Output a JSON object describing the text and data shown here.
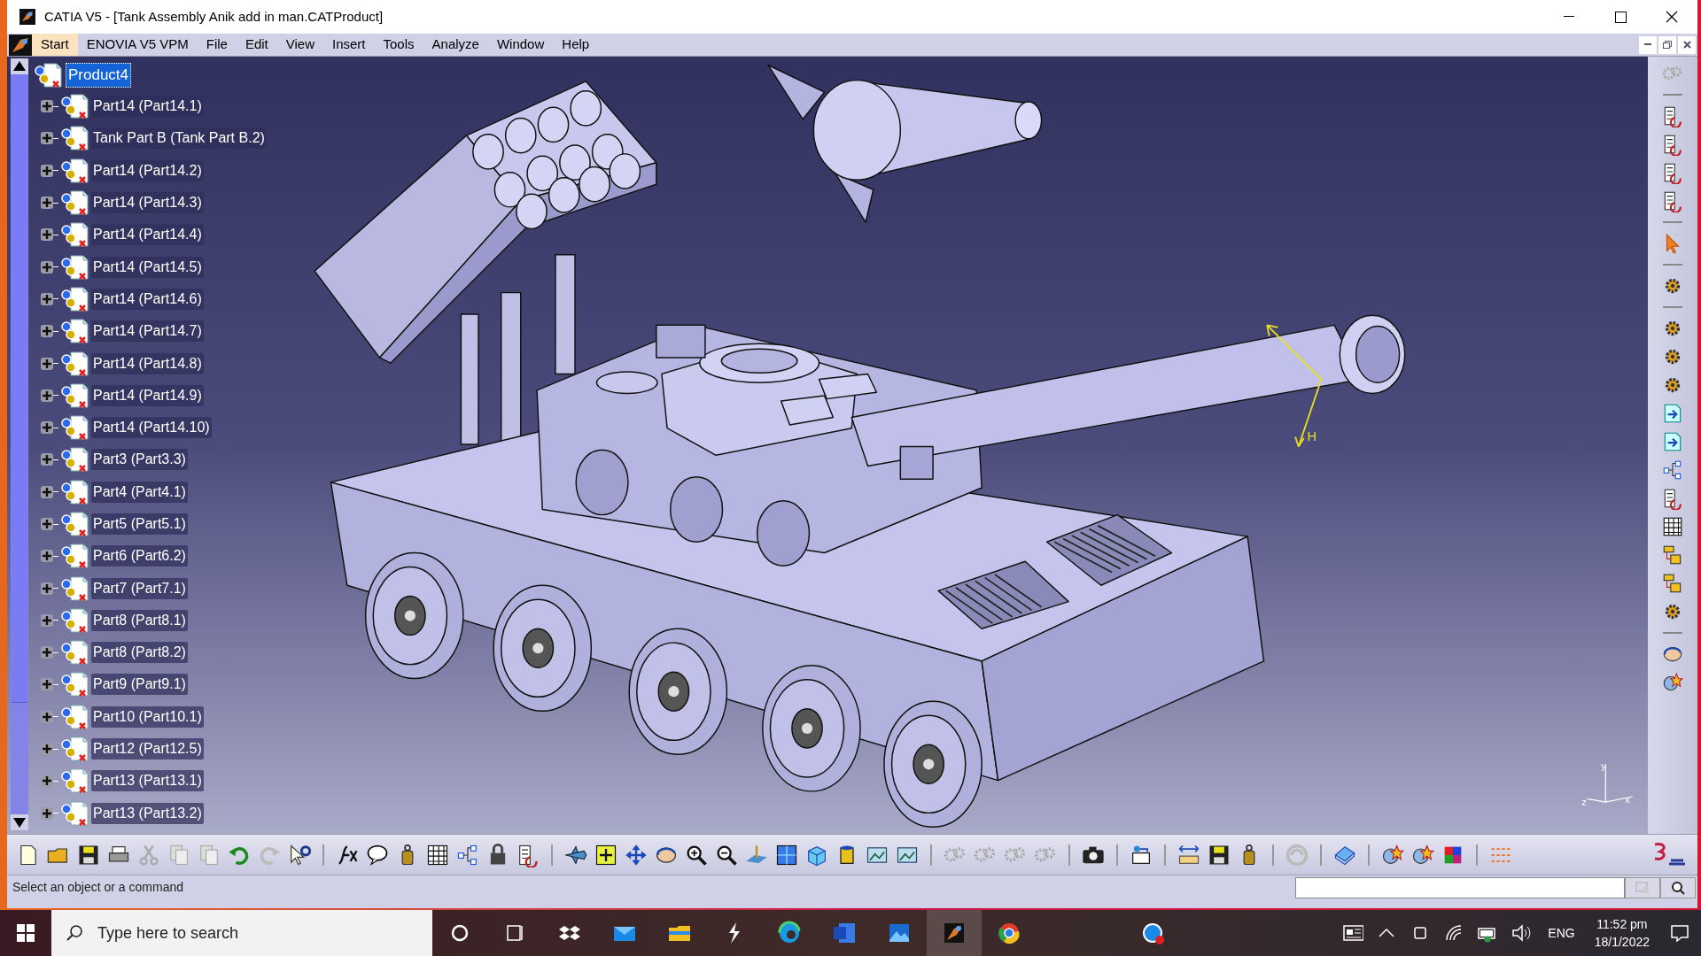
{
  "window": {
    "title": "CATIA V5 - [Tank Assembly Anik add in man.CATProduct]"
  },
  "menu": [
    {
      "label": "Start",
      "selected": true
    },
    {
      "label": "ENOVIA V5 VPM",
      "selected": false
    },
    {
      "label": "File",
      "selected": false
    },
    {
      "label": "Edit",
      "selected": false
    },
    {
      "label": "View",
      "selected": false
    },
    {
      "label": "Insert",
      "selected": false
    },
    {
      "label": "Tools",
      "selected": false
    },
    {
      "label": "Analyze",
      "selected": false
    },
    {
      "label": "Window",
      "selected": false
    },
    {
      "label": "Help",
      "selected": false
    }
  ],
  "tree": {
    "root": {
      "label": "Product4",
      "selected": true
    },
    "children": [
      {
        "label": "Part14 (Part14.1)",
        "expanded": false
      },
      {
        "label": "Tank Part B (Tank Part B.2)",
        "expanded": false
      },
      {
        "label": "Part14 (Part14.2)",
        "expanded": false
      },
      {
        "label": "Part14 (Part14.3)",
        "expanded": false
      },
      {
        "label": "Part14 (Part14.4)",
        "expanded": false
      },
      {
        "label": "Part14 (Part14.5)",
        "expanded": false
      },
      {
        "label": "Part14 (Part14.6)",
        "expanded": false
      },
      {
        "label": "Part14 (Part14.7)",
        "expanded": false
      },
      {
        "label": "Part14 (Part14.8)",
        "expanded": false
      },
      {
        "label": "Part14 (Part14.9)",
        "expanded": false
      },
      {
        "label": "Part14 (Part14.10)",
        "expanded": false
      },
      {
        "label": "Part3 (Part3.3)",
        "expanded": false
      },
      {
        "label": "Part4 (Part4.1)",
        "expanded": false
      },
      {
        "label": "Part5 (Part5.1)",
        "expanded": false
      },
      {
        "label": "Part6 (Part6.2)",
        "expanded": false
      },
      {
        "label": "Part7 (Part7.1)",
        "expanded": false
      },
      {
        "label": "Part8 (Part8.1)",
        "expanded": false
      },
      {
        "label": "Part8 (Part8.2)",
        "expanded": false
      },
      {
        "label": "Part9 (Part9.1)",
        "expanded": false
      },
      {
        "label": "Part10 (Part10.1)",
        "expanded": false
      },
      {
        "label": "Part12 (Part12.5)",
        "expanded": false
      },
      {
        "label": "Part13 (Part13.1)",
        "expanded": false
      },
      {
        "label": "Part13 (Part13.2)",
        "expanded": false
      }
    ]
  },
  "viewport": {
    "compass_label": "H",
    "axis_labels": {
      "y": "y",
      "x": "x",
      "z": "z"
    }
  },
  "status_bar": {
    "message": "Select an object or a command"
  },
  "taskbar": {
    "search_placeholder": "Type here to search",
    "language": "ENG",
    "time": "11:52 pm",
    "date": "18/1/2022"
  }
}
